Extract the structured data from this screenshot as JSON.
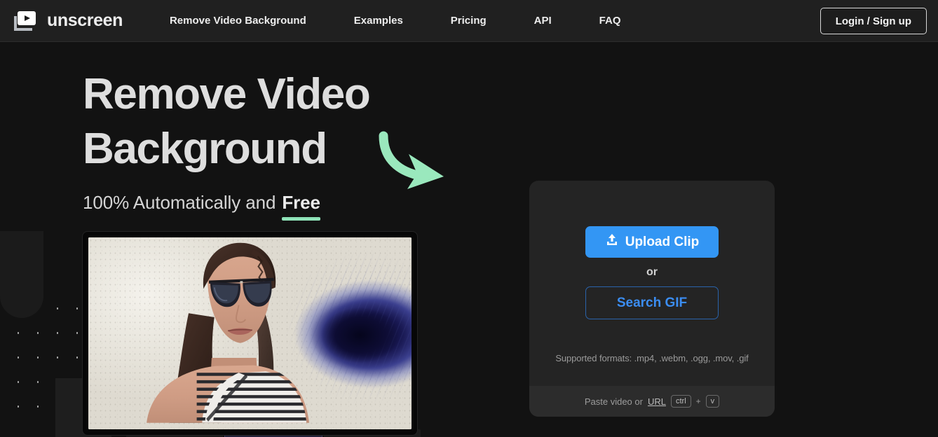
{
  "header": {
    "brand": "unscreen",
    "brand_icon": "video-play-stack-icon",
    "nav": [
      {
        "label": "Remove Video Background"
      },
      {
        "label": "Examples"
      },
      {
        "label": "Pricing"
      },
      {
        "label": "API"
      },
      {
        "label": "FAQ"
      }
    ],
    "login_label": "Login / Sign up"
  },
  "hero": {
    "title_line1": "Remove Video",
    "title_line2": "Background",
    "sub_prefix": "100% Automatically and",
    "sub_highlight": "Free",
    "arrow_icon": "curved-arrow-down-right-icon",
    "underline_color": "#8fe3b8",
    "arrow_color": "#9ae8bd"
  },
  "preview": {
    "caption": "video-preview"
  },
  "upload": {
    "upload_label": "Upload Clip",
    "upload_icon": "upload-icon",
    "or_label": "or",
    "search_gif_label": "Search GIF",
    "formats_label": "Supported formats: .mp4, .webm, .ogg, .mov, .gif",
    "paste_prefix": "Paste video or",
    "paste_link": "URL",
    "key_modifier": "ctrl",
    "key_plus": "+",
    "key_letter": "v",
    "primary_color": "#3396f4",
    "secondary_color": "#3b8df2"
  }
}
